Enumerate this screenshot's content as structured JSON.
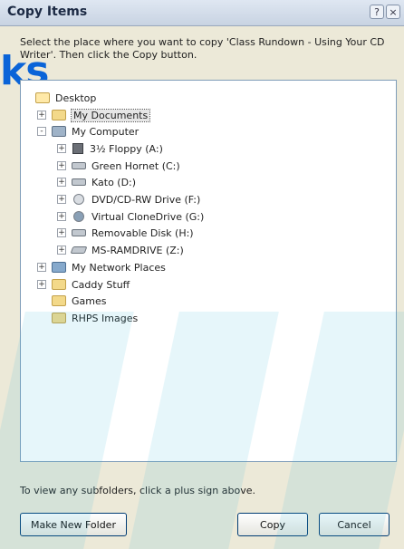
{
  "window": {
    "title": "Copy Items",
    "help_glyph": "?",
    "close_glyph": "×"
  },
  "instruction": "Select the place where you want to copy 'Class Rundown - Using Your CD Writer'. Then click the Copy button.",
  "overlay_text": "ks",
  "tree": {
    "items": [
      {
        "label": "Desktop",
        "icon": "desktop-icon",
        "expander": ""
      },
      {
        "label": "My Documents",
        "icon": "folder-icon",
        "expander": "+"
      },
      {
        "label": "My Computer",
        "icon": "computer-icon",
        "expander": "-"
      },
      {
        "label": "3½ Floppy (A:)",
        "icon": "floppy-icon",
        "expander": "+"
      },
      {
        "label": "Green Hornet (C:)",
        "icon": "drive-icon",
        "expander": "+"
      },
      {
        "label": "Kato (D:)",
        "icon": "drive-icon",
        "expander": "+"
      },
      {
        "label": "DVD/CD-RW Drive (F:)",
        "icon": "cd-drive-icon",
        "expander": "+"
      },
      {
        "label": "Virtual CloneDrive (G:)",
        "icon": "virtual-drive-icon",
        "expander": "+"
      },
      {
        "label": "Removable Disk (H:)",
        "icon": "removable-drive-icon",
        "expander": "+"
      },
      {
        "label": "MS-RAMDRIVE (Z:)",
        "icon": "ram-drive-icon",
        "expander": "+"
      },
      {
        "label": "My Network Places",
        "icon": "network-icon",
        "expander": "+"
      },
      {
        "label": "Caddy Stuff",
        "icon": "folder-icon",
        "expander": "+"
      },
      {
        "label": "Games",
        "icon": "folder-icon",
        "expander": ""
      },
      {
        "label": "RHPS Images",
        "icon": "folder-icon",
        "expander": ""
      }
    ]
  },
  "footer": {
    "hint": "To view any subfolders, click a plus sign above."
  },
  "buttons": {
    "make_new_folder": "Make New Folder",
    "copy": "Copy",
    "cancel": "Cancel"
  }
}
